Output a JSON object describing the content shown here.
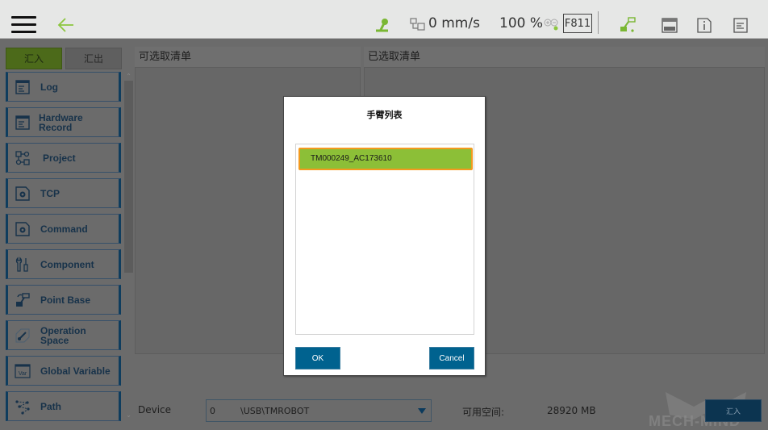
{
  "topbar": {
    "speed": "0 mm/s",
    "percent": "100 %",
    "firmware_badge": "F811",
    "icons": [
      "menu-icon",
      "back-arrow-icon",
      "robot-status-icon",
      "speed-icon",
      "zoom-in-out-icon",
      "robot-arm-icon",
      "display-icon",
      "info-icon",
      "log-icon"
    ]
  },
  "sidebar": {
    "tabs": [
      {
        "label": "汇入",
        "active": true
      },
      {
        "label": "汇出",
        "active": false
      }
    ],
    "items": [
      {
        "label": "Log",
        "icon": "log-icon"
      },
      {
        "label": "Hardware Record",
        "icon": "hardware-record-icon"
      },
      {
        "label": "Project",
        "icon": "project-flow-icon"
      },
      {
        "label": "TCP",
        "icon": "tcp-gear-icon"
      },
      {
        "label": "Command",
        "icon": "command-gear-icon"
      },
      {
        "label": "Component",
        "icon": "component-tools-icon"
      },
      {
        "label": "Point Base",
        "icon": "point-base-icon"
      },
      {
        "label": "Operation Space",
        "label_line1": "Operation",
        "label_line2": "Space",
        "icon": "operation-space-icon"
      },
      {
        "label": "Global Variable",
        "icon": "global-variable-icon"
      },
      {
        "label": "Path",
        "icon": "path-icon"
      }
    ]
  },
  "panels": {
    "available_title": "可选取清单",
    "selected_title": "已选取清单"
  },
  "footer": {
    "device_label": "Device",
    "device_value": {
      "index": "0",
      "path": "\\USB\\TMROBOT"
    },
    "free_space_label": "可用空间:",
    "free_space_value": "28920 MB",
    "import_button": "汇入",
    "watermark": "MECH-MIND"
  },
  "dialog": {
    "title": "手臂列表",
    "items": [
      {
        "label": "TM000249_AC173610",
        "selected": true
      }
    ],
    "ok_label": "OK",
    "cancel_label": "Cancel"
  },
  "colors": {
    "accent_green": "#8cbf37",
    "selection_border": "#f39a1f",
    "button_blue": "#00628f",
    "nav_blue": "#0f3d5e"
  }
}
